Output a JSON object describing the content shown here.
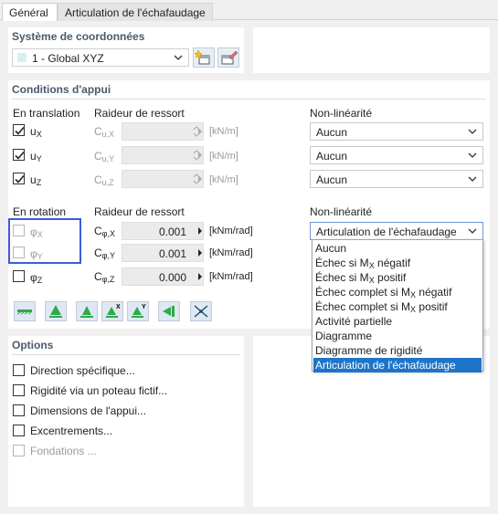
{
  "tabs": [
    {
      "label": "Général"
    },
    {
      "label": "Articulation de l'échafaudage"
    }
  ],
  "coords": {
    "title": "Système de coordonnées",
    "selected": "1 - Global XYZ"
  },
  "conditions": {
    "title": "Conditions d'appui",
    "translation_header": "En translation",
    "spring_header": "Raideur de ressort",
    "nonlin_header": "Non-linéarité",
    "translation_rows": [
      {
        "label": "u",
        "sub": "X",
        "checked": true,
        "c_label": "C",
        "c_sub": "u,X",
        "unit": "[kN/m]",
        "nonlin": "Aucun"
      },
      {
        "label": "u",
        "sub": "Y",
        "checked": true,
        "c_label": "C",
        "c_sub": "u,Y",
        "unit": "[kN/m]",
        "nonlin": "Aucun"
      },
      {
        "label": "u",
        "sub": "Z",
        "checked": true,
        "c_label": "C",
        "c_sub": "u,Z",
        "unit": "[kN/m]",
        "nonlin": "Aucun"
      }
    ],
    "rotation_header": "En rotation",
    "spring_header2": "Raideur de ressort",
    "nonlin_header2": "Non-linéarité",
    "rotation_rows": [
      {
        "label": "φ",
        "sub": "X",
        "checked": false,
        "c_label": "C",
        "c_sub": "φ,X",
        "value": "0.001",
        "unit": "[kNm/rad]"
      },
      {
        "label": "φ",
        "sub": "Y",
        "checked": false,
        "c_label": "C",
        "c_sub": "φ,Y",
        "value": "0.001",
        "unit": "[kNm/rad]"
      },
      {
        "label": "φ",
        "sub": "Z",
        "checked": false,
        "c_label": "C",
        "c_sub": "φ,Z",
        "value": "0.000",
        "unit": "[kNm/rad]"
      }
    ],
    "rotation_nonlin_selected": "Articulation de l'échafaudage"
  },
  "dropdown": {
    "items": [
      {
        "text": "Aucun"
      },
      {
        "text": "Échec si M",
        "sub": "X",
        "tail": " négatif"
      },
      {
        "text": "Échec si M",
        "sub": "X",
        "tail": " positif"
      },
      {
        "text": "Échec complet si M",
        "sub": "X",
        "tail": " négatif"
      },
      {
        "text": "Échec complet si M",
        "sub": "X",
        "tail": " positif"
      },
      {
        "text": "Activité partielle"
      },
      {
        "text": "Diagramme"
      },
      {
        "text": "Diagramme de rigidité"
      },
      {
        "text": "Articulation de l'échafaudage"
      }
    ],
    "selected_index": 8
  },
  "options": {
    "title": "Options",
    "items": [
      {
        "label": "Direction spécifique...",
        "enabled": true
      },
      {
        "label": "Rigidité via un poteau fictif...",
        "enabled": true
      },
      {
        "label": "Dimensions de l'appui...",
        "enabled": true
      },
      {
        "label": "Excentrements...",
        "enabled": true
      },
      {
        "label": "Fondations ...",
        "enabled": false
      }
    ]
  },
  "colors": {
    "accent": "#1e74c8",
    "section_title": "#4a5a6e",
    "highlight_box": "#3d5bd9",
    "icon_green": "#2daa4a"
  }
}
